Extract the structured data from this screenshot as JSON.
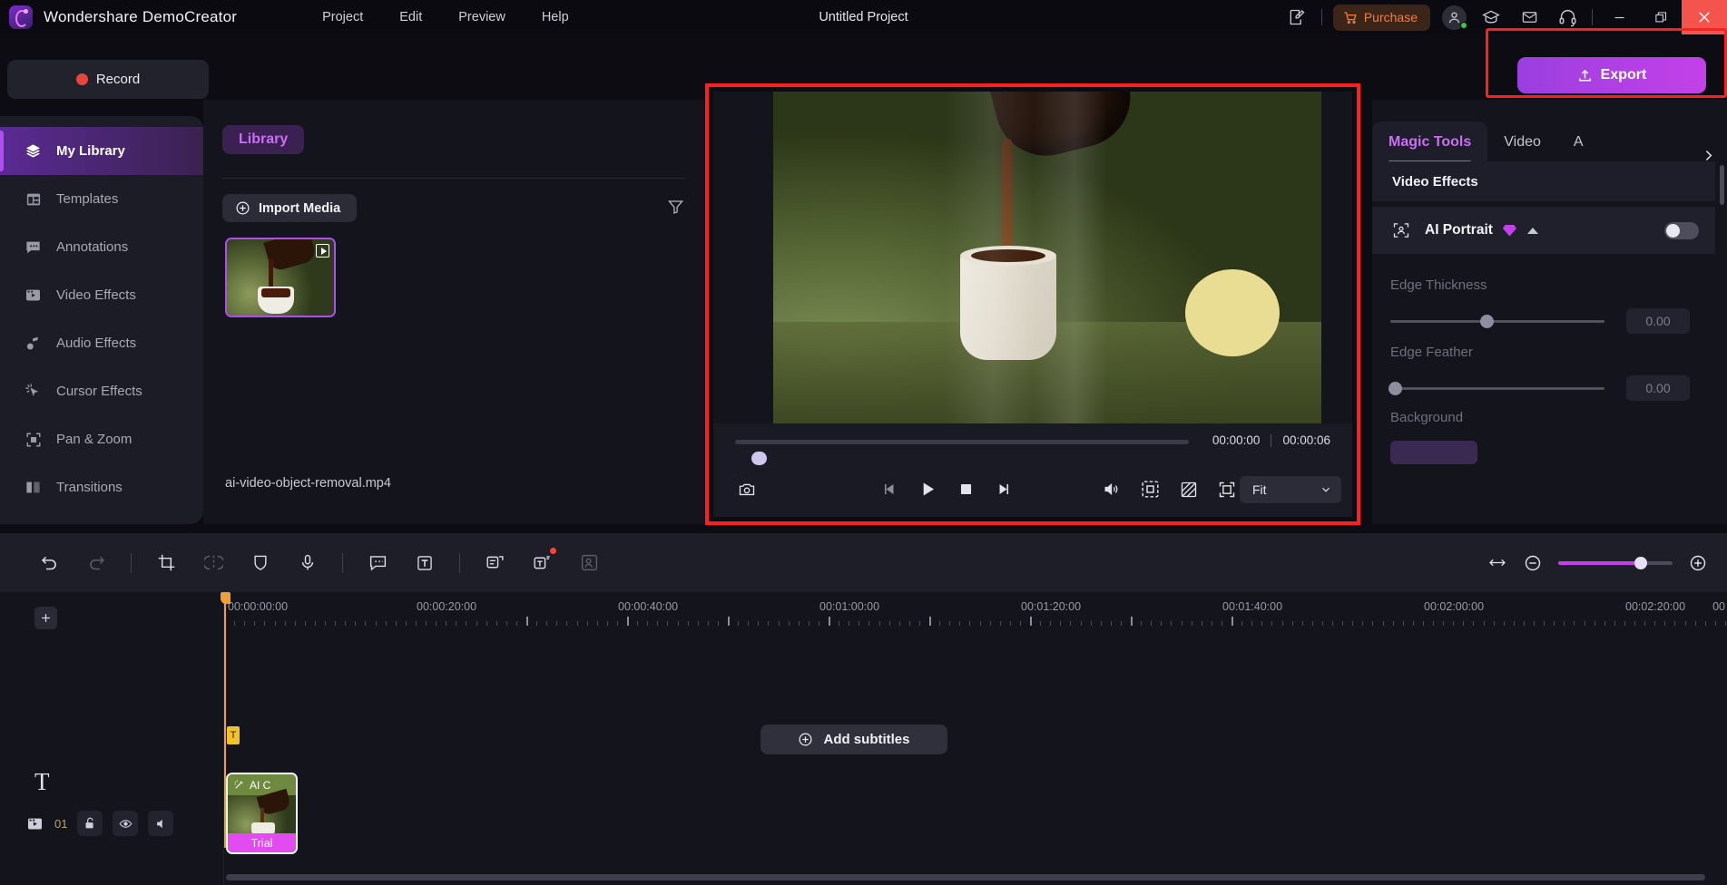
{
  "titlebar": {
    "app_name": "Wondershare DemoCreator",
    "menus": [
      "Project",
      "Edit",
      "Preview",
      "Help"
    ],
    "project_title": "Untitled Project",
    "purchase_label": "Purchase",
    "icons": [
      "feedback-icon",
      "account-icon",
      "tutorial-icon",
      "mail-icon",
      "support-icon"
    ],
    "window_controls": [
      "minimize",
      "restore",
      "close"
    ]
  },
  "toolbar_top": {
    "record_label": "Record",
    "export_label": "Export"
  },
  "sidebar": {
    "items": [
      {
        "label": "My Library",
        "icon": "layers-icon",
        "active": true
      },
      {
        "label": "Templates",
        "icon": "templates-icon",
        "active": false
      },
      {
        "label": "Annotations",
        "icon": "annotations-icon",
        "active": false
      },
      {
        "label": "Video Effects",
        "icon": "video-effects-icon",
        "active": false
      },
      {
        "label": "Audio Effects",
        "icon": "audio-effects-icon",
        "active": false
      },
      {
        "label": "Cursor Effects",
        "icon": "cursor-effects-icon",
        "active": false
      },
      {
        "label": "Pan & Zoom",
        "icon": "pan-zoom-icon",
        "active": false
      },
      {
        "label": "Transitions",
        "icon": "transitions-icon",
        "active": false
      }
    ]
  },
  "library": {
    "tab_label": "Library",
    "import_label": "Import Media",
    "filter_icon": "filter-icon",
    "media": [
      {
        "name": "ai-video-object-removal.mp4",
        "type": "video",
        "selected": true
      }
    ]
  },
  "preview": {
    "current_time": "00:00:00",
    "total_time": "00:00:06",
    "scale_value": "Fit",
    "controls": [
      "snapshot-icon",
      "prev-frame-icon",
      "play-icon",
      "stop-icon",
      "next-frame-icon",
      "volume-icon",
      "crop-preview-icon",
      "split-screen-icon",
      "fullscreen-icon"
    ]
  },
  "right_panel": {
    "tabs": [
      {
        "label": "Magic Tools",
        "active": true
      },
      {
        "label": "Video",
        "active": false
      },
      {
        "label": "A",
        "active": false
      }
    ],
    "section_title": "Video Effects",
    "effect": {
      "name": "AI Portrait",
      "badge": "premium-gem",
      "enabled": false
    },
    "properties": [
      {
        "label": "Edge Thickness",
        "value": "0.00",
        "knob_pct": 45
      },
      {
        "label": "Edge Feather",
        "value": "0.00",
        "knob_pct": 0
      }
    ],
    "background_label": "Background"
  },
  "edit_toolbar": {
    "tools": [
      "undo-icon",
      "redo-icon",
      "crop-icon",
      "split-icon",
      "mask-icon",
      "voice-record-icon",
      "caption-icon",
      "text-icon",
      "auto-subtitle-icon",
      "text-to-speech-icon",
      "ai-avatar-icon"
    ],
    "right_tools": [
      "fit-timeline-icon",
      "zoom-out-icon",
      "zoom-slider",
      "zoom-in-icon"
    ]
  },
  "timeline": {
    "add_track_icon": "add-track-icon",
    "text_track_icon": "text-track-icon",
    "track_number": "01",
    "track_controls": [
      "video-track-icon",
      "lock-icon",
      "eye-icon",
      "mute-icon"
    ],
    "ruler_labels": [
      "00:00:00:00",
      "00:00:20:00",
      "00:00:40:00",
      "00:01:00:00",
      "00:01:20:00",
      "00:01:40:00",
      "00"
    ],
    "add_subtitles_label": "Add subtitles",
    "clip": {
      "header_label": "AI C",
      "header_icon": "magic-wand-icon",
      "footer_label": "Trial"
    }
  },
  "colors": {
    "accent_purple": "#c341e8",
    "highlight_red": "#ff1f1f",
    "purchase_orange": "#ff7a33",
    "playhead_orange": "#f0a030",
    "clip_trial": "#e24bf0"
  }
}
